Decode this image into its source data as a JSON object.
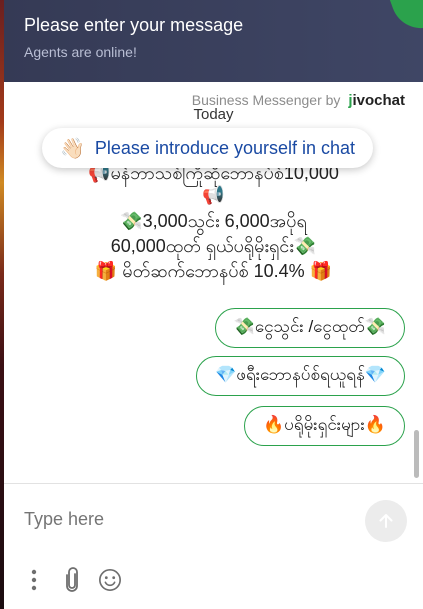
{
  "header": {
    "title": "Please enter your message",
    "subtitle": "Agents are online!"
  },
  "brand": {
    "prefix": "Business Messenger by",
    "logo_j": "j",
    "logo_rest": "ivochat"
  },
  "chat": {
    "today_label": "Today",
    "message_lines": [
      "📢မန်ဘာသစ်ကြိုဆိုဘောနပ်စ်10,000",
      "📢",
      "💸3,000သွင်း 6,000အပိုရ",
      "60,000ထုတ် ရှယ်ပရိုမိုးရှင်း💸",
      "🎁 မိတ်ဆက်ဘောနပ်စ် 10.4% 🎁"
    ],
    "intro_prompt": {
      "icon": "👋🏻",
      "label": "Please introduce yourself in chat"
    },
    "quick_replies": [
      "💸ငွေသွင်း /ငွေထုတ်💸",
      "💎ဖရီးဘောနပ်စ်ရယူရန်💎",
      "🔥ပရိုမိုးရှင်းများ🔥"
    ]
  },
  "composer": {
    "placeholder": "Type here"
  },
  "colors": {
    "header_bg": "#373c59",
    "accent_green": "#2ba24c",
    "link_blue": "#1a4aa3"
  },
  "icons": [
    "more-vertical-icon",
    "paperclip-icon",
    "smiley-icon",
    "send-arrow-icon",
    "wave-hand-icon"
  ]
}
